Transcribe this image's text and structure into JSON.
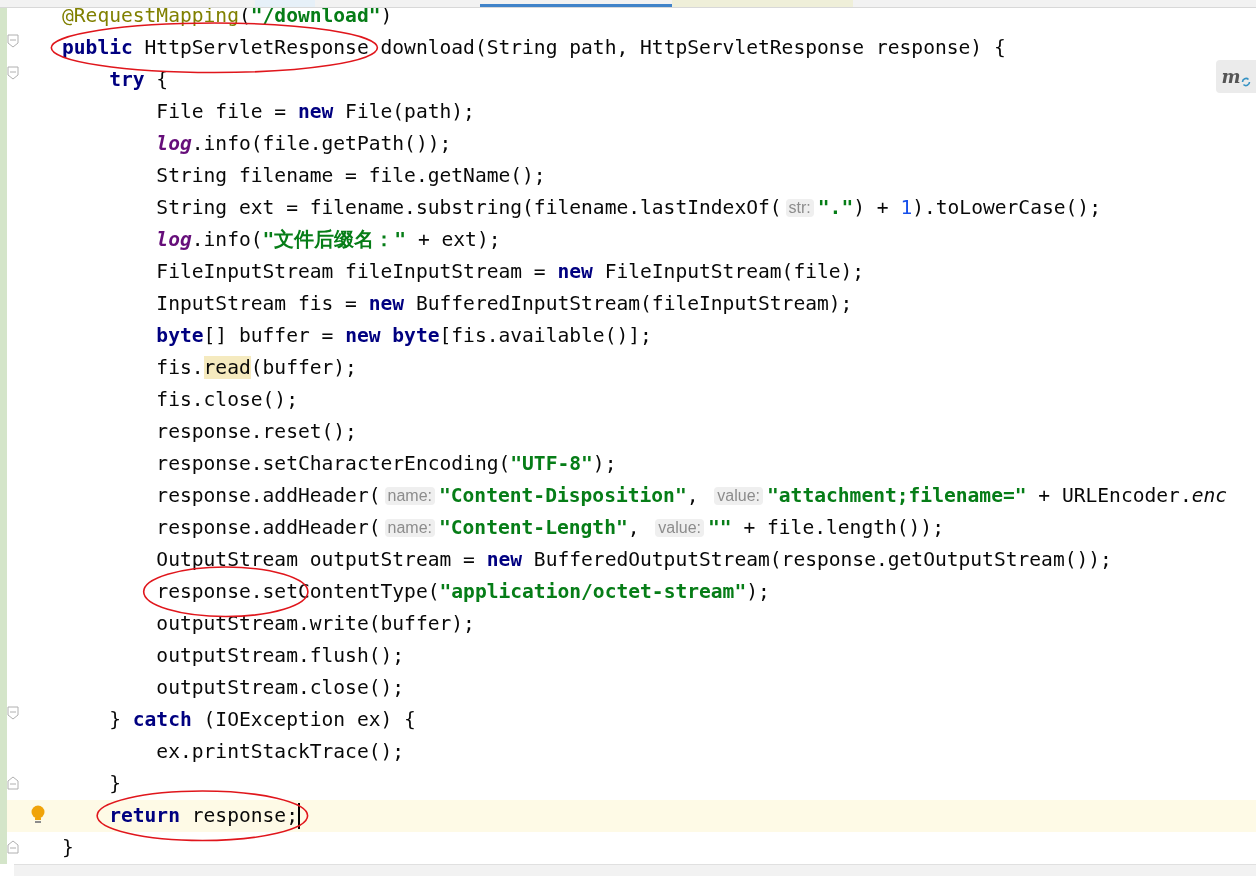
{
  "floating_button": {
    "label": "m"
  },
  "lines": [
    {
      "tokens": [
        {
          "kind": "annotation",
          "text": "@RequestMapping"
        },
        {
          "kind": "plain",
          "text": "("
        },
        {
          "kind": "string",
          "text": "\"/download\""
        },
        {
          "kind": "plain",
          "text": ")"
        }
      ]
    },
    {
      "fold_start": true,
      "tokens": [
        {
          "kind": "group",
          "circled": true,
          "tokens": [
            {
              "kind": "keyword",
              "text": "public"
            },
            {
              "kind": "plain",
              "text": " HttpServletResponse"
            }
          ]
        },
        {
          "kind": "plain",
          "text": " download(String path, HttpServletResponse response) {"
        }
      ]
    },
    {
      "fold_start": true,
      "tokens": [
        {
          "kind": "keyword",
          "text": "    try"
        },
        {
          "kind": "plain",
          "text": " {"
        }
      ]
    },
    {
      "tokens": [
        {
          "kind": "plain",
          "text": "        File file = "
        },
        {
          "kind": "keyword",
          "text": "new"
        },
        {
          "kind": "plain",
          "text": " File(path);"
        }
      ]
    },
    {
      "tokens": [
        {
          "kind": "field",
          "text": "        log"
        },
        {
          "kind": "plain",
          "text": ".info(file.getPath());"
        }
      ]
    },
    {
      "tokens": [
        {
          "kind": "plain",
          "text": "        String filename = file.getName();"
        }
      ]
    },
    {
      "tokens": [
        {
          "kind": "plain",
          "text": "        String ext = filename.substring(filename.lastIndexOf("
        },
        {
          "kind": "hint",
          "text": "str:"
        },
        {
          "kind": "string",
          "text": "\".\""
        },
        {
          "kind": "plain",
          "text": ") + "
        },
        {
          "kind": "number",
          "text": "1"
        },
        {
          "kind": "plain",
          "text": ").toLowerCase();"
        }
      ]
    },
    {
      "tokens": [
        {
          "kind": "field",
          "text": "        log"
        },
        {
          "kind": "plain",
          "text": ".info("
        },
        {
          "kind": "string",
          "text": "\"文件后缀名：\""
        },
        {
          "kind": "plain",
          "text": " + ext);"
        }
      ]
    },
    {
      "tokens": [
        {
          "kind": "plain",
          "text": "        FileInputStream fileInputStream = "
        },
        {
          "kind": "keyword",
          "text": "new"
        },
        {
          "kind": "plain",
          "text": " FileInputStream(file);"
        }
      ]
    },
    {
      "tokens": [
        {
          "kind": "plain",
          "text": "        InputStream fis = "
        },
        {
          "kind": "keyword",
          "text": "new"
        },
        {
          "kind": "plain",
          "text": " BufferedInputStream(fileInputStream);"
        }
      ]
    },
    {
      "tokens": [
        {
          "kind": "keyword",
          "text": "        byte"
        },
        {
          "kind": "plain",
          "text": "[] buffer = "
        },
        {
          "kind": "keyword",
          "text": "new"
        },
        {
          "kind": "keyword",
          "text": " byte"
        },
        {
          "kind": "plain",
          "text": "[fis.available()];"
        }
      ]
    },
    {
      "tokens": [
        {
          "kind": "plain",
          "text": "        fis."
        },
        {
          "kind": "plain",
          "text": "read",
          "highlighted": true
        },
        {
          "kind": "plain",
          "text": "(buffer);"
        }
      ]
    },
    {
      "tokens": [
        {
          "kind": "plain",
          "text": "        fis.close();"
        }
      ]
    },
    {
      "tokens": [
        {
          "kind": "plain",
          "text": "        response.reset();"
        }
      ]
    },
    {
      "tokens": [
        {
          "kind": "plain",
          "text": "        response.setCharacterEncoding("
        },
        {
          "kind": "string",
          "text": "\"UTF-8\""
        },
        {
          "kind": "plain",
          "text": ");"
        }
      ]
    },
    {
      "tokens": [
        {
          "kind": "plain",
          "text": "        response.addHeader("
        },
        {
          "kind": "hint",
          "text": "name:"
        },
        {
          "kind": "string",
          "text": "\"Content-Disposition\""
        },
        {
          "kind": "plain",
          "text": ", "
        },
        {
          "kind": "hint",
          "text": "value:"
        },
        {
          "kind": "string",
          "text": "\"attachment;filename=\""
        },
        {
          "kind": "plain",
          "text": " + URLEncoder."
        },
        {
          "kind": "static",
          "text": "enc"
        }
      ]
    },
    {
      "tokens": [
        {
          "kind": "plain",
          "text": "        response.addHeader("
        },
        {
          "kind": "hint",
          "text": "name:"
        },
        {
          "kind": "string",
          "text": "\"Content-Length\""
        },
        {
          "kind": "plain",
          "text": ", "
        },
        {
          "kind": "hint",
          "text": "value:"
        },
        {
          "kind": "string",
          "text": "\"\""
        },
        {
          "kind": "plain",
          "text": " + file.length());"
        }
      ]
    },
    {
      "tokens": [
        {
          "kind": "plain",
          "text": "        OutputStream outputStream = "
        },
        {
          "kind": "keyword",
          "text": "new"
        },
        {
          "kind": "plain",
          "text": " BufferedOutputStream(response.getOutputStream());"
        }
      ]
    },
    {
      "tokens": [
        {
          "kind": "group",
          "circled": true,
          "tokens": [
            {
              "kind": "plain",
              "text": "        response.set"
            }
          ]
        },
        {
          "kind": "plain",
          "text": "ContentType("
        },
        {
          "kind": "string",
          "text": "\"application/octet-stream\""
        },
        {
          "kind": "plain",
          "text": ");"
        }
      ]
    },
    {
      "tokens": [
        {
          "kind": "plain",
          "text": "        outputStream.write(buffer);"
        }
      ]
    },
    {
      "tokens": [
        {
          "kind": "plain",
          "text": "        outputStream.flush();"
        }
      ]
    },
    {
      "tokens": [
        {
          "kind": "plain",
          "text": "        outputStream.close();"
        }
      ]
    },
    {
      "fold_start": true,
      "tokens": [
        {
          "kind": "plain",
          "text": "    } "
        },
        {
          "kind": "keyword",
          "text": "catch"
        },
        {
          "kind": "plain",
          "text": " (IOException ex) {"
        }
      ]
    },
    {
      "tokens": [
        {
          "kind": "plain",
          "text": "        ex.printStackTrace();"
        }
      ]
    },
    {
      "fold_end": true,
      "tokens": [
        {
          "kind": "plain",
          "text": "    }"
        }
      ]
    },
    {
      "current": true,
      "bulb": true,
      "caret": true,
      "tokens": [
        {
          "kind": "group",
          "circled": true,
          "tokens": [
            {
              "kind": "keyword",
              "text": "    return"
            },
            {
              "kind": "plain",
              "text": " response;"
            }
          ]
        }
      ]
    },
    {
      "fold_end": true,
      "tokens": [
        {
          "kind": "plain",
          "text": "}"
        }
      ]
    }
  ]
}
